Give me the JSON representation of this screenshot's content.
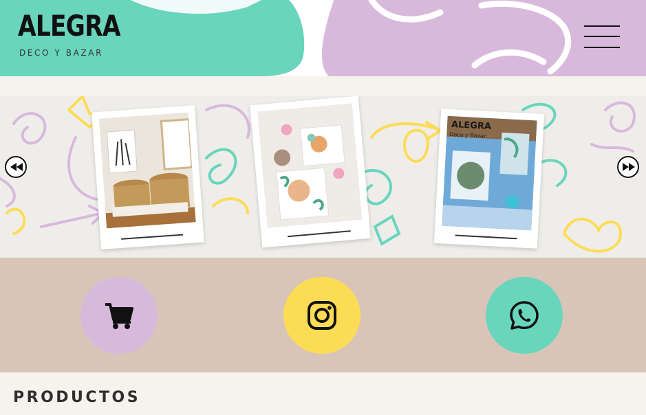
{
  "header": {
    "brand_name": "ALEGRA",
    "brand_tagline": "DECO Y BAZAR",
    "menu_icon": "hamburger-menu-icon",
    "colors": {
      "mint": "#69d5bd",
      "lilac": "#d8b9dc"
    }
  },
  "gallery": {
    "prev_icon": "rewind-icon",
    "next_icon": "fast-forward-icon",
    "slide_3_logo_title": "ALEGRA",
    "slide_3_logo_sub": "Deco y Bazar"
  },
  "social": {
    "cart_icon": "cart-icon",
    "instagram_icon": "instagram-icon",
    "whatsapp_icon": "whatsapp-icon",
    "colors": {
      "strip": "#d9c5b8",
      "cart": "#d8b9dc",
      "instagram": "#fddc55",
      "whatsapp": "#69d5bd"
    }
  },
  "productos": {
    "title": "PRODUCTOS"
  }
}
